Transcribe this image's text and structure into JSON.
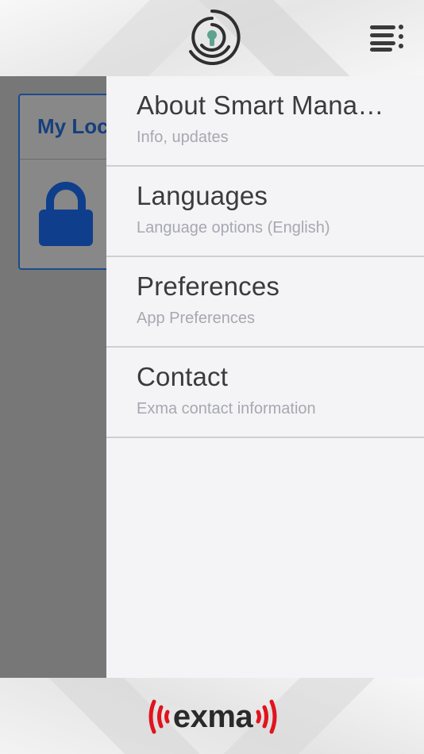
{
  "header": {
    "logo_icon": "keyhole-logo-icon",
    "menu_icon": "menu-icon"
  },
  "background": {
    "card_title": "My Loc",
    "card_icon": "lock-icon"
  },
  "drawer": {
    "items": [
      {
        "title": "About Smart Mana…",
        "subtitle": "Info, updates"
      },
      {
        "title": "Languages",
        "subtitle": "Language options (English)"
      },
      {
        "title": "Preferences",
        "subtitle": "App Preferences"
      },
      {
        "title": "Contact",
        "subtitle": "Exma contact information"
      }
    ]
  },
  "footer": {
    "brand": "exma"
  },
  "colors": {
    "accent_blue": "#163f7c",
    "brand_red": "#e0141e",
    "logo_teal": "#5fa38f",
    "drawer_bg": "#f4f4f6",
    "overlay": "#777777"
  }
}
